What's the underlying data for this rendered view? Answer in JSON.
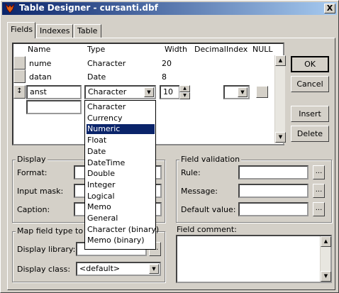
{
  "window": {
    "title": "Table Designer - cursanti.dbf",
    "close_label": "X"
  },
  "tabs": [
    {
      "label": "Fields"
    },
    {
      "label": "Indexes"
    },
    {
      "label": "Table"
    }
  ],
  "grid": {
    "headers": {
      "name": "Name",
      "type": "Type",
      "width": "Width",
      "decimal": "Decimal",
      "index": "Index",
      "null": "NULL"
    },
    "rows": [
      {
        "name": "nume",
        "type": "Character",
        "width": "20"
      },
      {
        "name": "datan",
        "type": "Date",
        "width": "8"
      }
    ],
    "edit_row": {
      "selector": "↕",
      "name": "anst",
      "type": "Character",
      "width": "10"
    }
  },
  "type_options": [
    "Character",
    "Currency",
    "Numeric",
    "Float",
    "Date",
    "DateTime",
    "Double",
    "Integer",
    "Logical",
    "Memo",
    "General",
    "Character (binary)",
    "Memo (binary)"
  ],
  "type_selected_index": 2,
  "buttons": {
    "ok": "OK",
    "cancel": "Cancel",
    "insert": "Insert",
    "delete": "Delete"
  },
  "display": {
    "group_label": "Display",
    "format_label": "Format:",
    "input_mask_label": "Input mask:",
    "caption_label": "Caption:"
  },
  "map": {
    "group_label": "Map field type to cla",
    "library_label": "Display library:",
    "class_label": "Display class:",
    "class_value": "<default>"
  },
  "validation": {
    "group_label": "Field validation",
    "rule_label": "Rule:",
    "message_label": "Message:",
    "default_label": "Default value:",
    "ellipsis": "..."
  },
  "comment": {
    "label": "Field comment:"
  }
}
